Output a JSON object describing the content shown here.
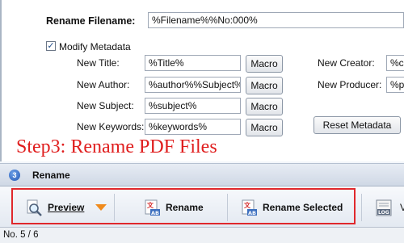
{
  "rename": {
    "label": "Rename Filename:",
    "value": "%Filename%%No:000%"
  },
  "metadata": {
    "checkbox_label": "Modify Metadata",
    "checked": true,
    "checkmark": "✓",
    "fields": [
      {
        "label": "New Title:",
        "value": "%Title%"
      },
      {
        "label": "New Author:",
        "value": "%author%%Subject%"
      },
      {
        "label": "New Subject:",
        "value": "%subject%"
      },
      {
        "label": "New Keywords:",
        "value": "%keywords%"
      }
    ],
    "macro_label": "Macro",
    "right_fields": [
      {
        "label": "New Creator:",
        "value": "%cr"
      },
      {
        "label": "New Producer:",
        "value": "%pr"
      }
    ],
    "reset_label": "Reset Metadata"
  },
  "annotation": {
    "text": "Step3: Rename PDF Files",
    "color": "#e01e1e"
  },
  "section": {
    "number": "3",
    "title": "Rename"
  },
  "toolbar": {
    "preview_label": "Preview",
    "rename_label": "Rename",
    "rename_selected_label": "Rename Selected",
    "log_label": "LOG",
    "truncated_label": "V"
  },
  "status": {
    "text": "No. 5 / 6"
  }
}
